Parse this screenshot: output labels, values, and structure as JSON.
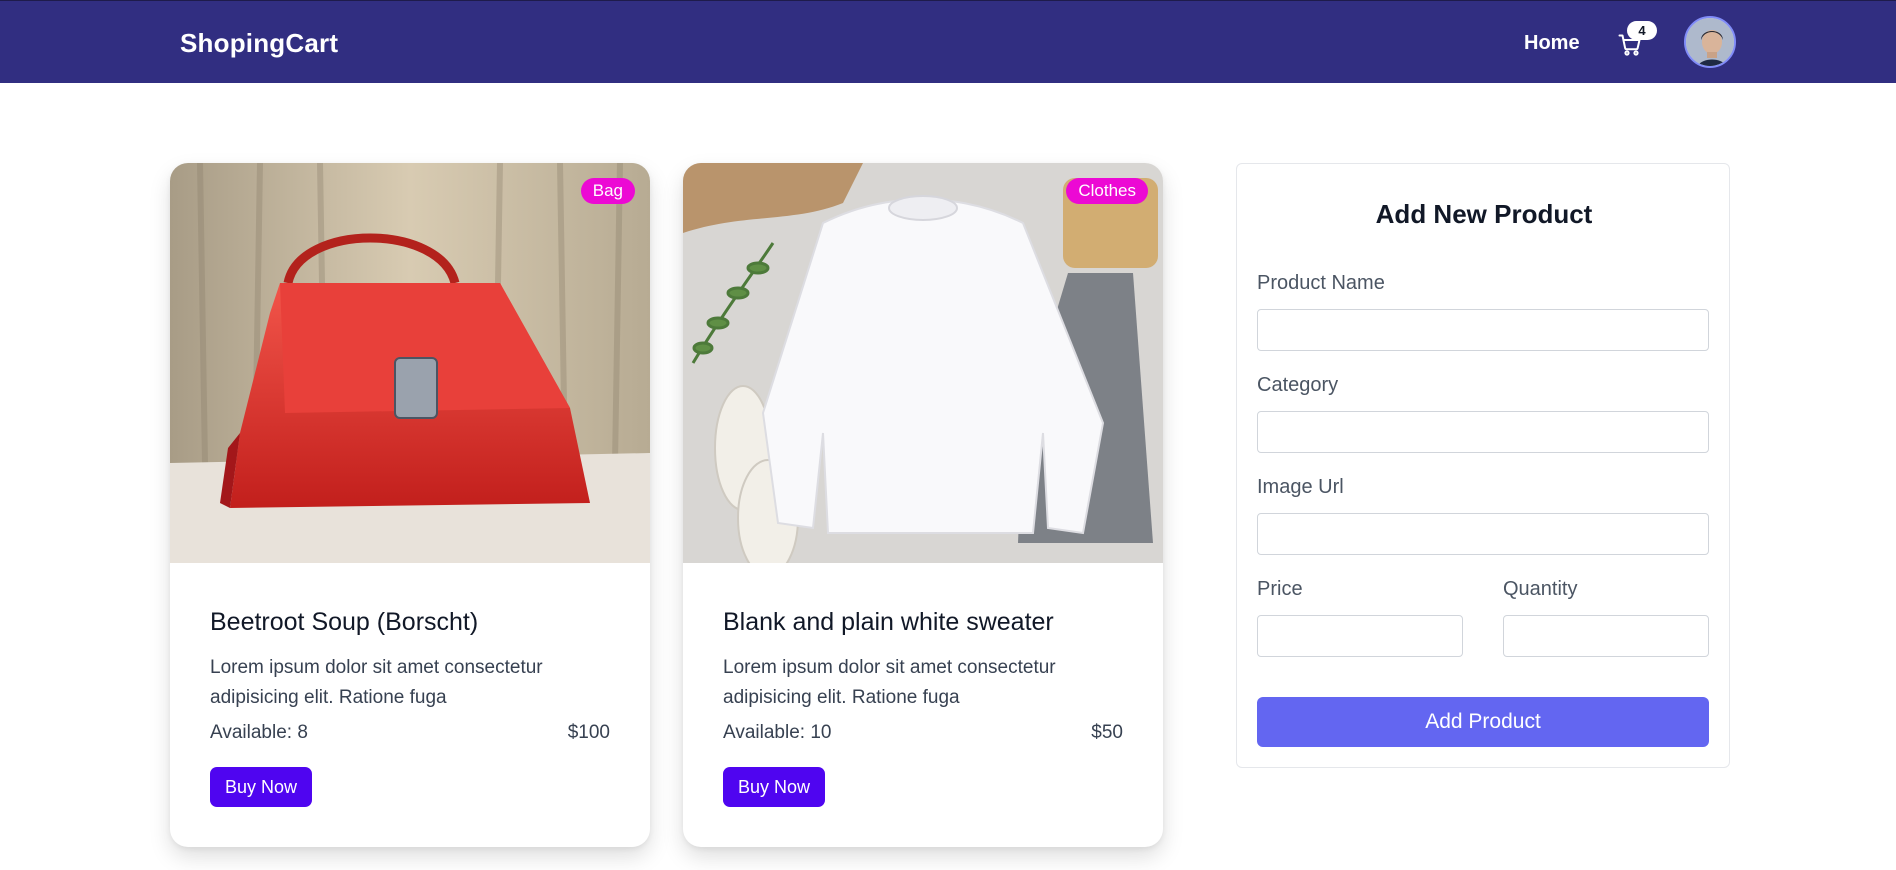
{
  "navbar": {
    "brand": "ShopingCart",
    "home_label": "Home",
    "cart_count": "4",
    "cart_icon": "shopping-cart-icon",
    "avatar_icon": "user-avatar"
  },
  "products": [
    {
      "category": "Bag",
      "title": "Beetroot Soup (Borscht)",
      "description": "Lorem ipsum dolor sit amet consectetur adipisicing elit. Ratione fuga",
      "available": "Available: 8",
      "price": "$100",
      "button_label": "Buy Now"
    },
    {
      "category": "Clothes",
      "title": "Blank and plain white sweater",
      "description": "Lorem ipsum dolor sit amet consectetur adipisicing elit. Ratione fuga",
      "available": "Available: 10",
      "price": "$50",
      "button_label": "Buy Now"
    }
  ],
  "form": {
    "title": "Add New Product",
    "product_name_label": "Product Name",
    "product_name_value": "",
    "category_label": "Category",
    "category_value": "",
    "image_url_label": "Image Url",
    "image_url_value": "",
    "price_label": "Price",
    "price_value": "",
    "quantity_label": "Quantity",
    "quantity_value": "",
    "submit_label": "Add Product"
  },
  "colors": {
    "navbar_bg": "#312e81",
    "badge_bg": "#ec09d4",
    "buy_button_bg": "#4f05f0",
    "add_button_bg": "#6366f1"
  }
}
